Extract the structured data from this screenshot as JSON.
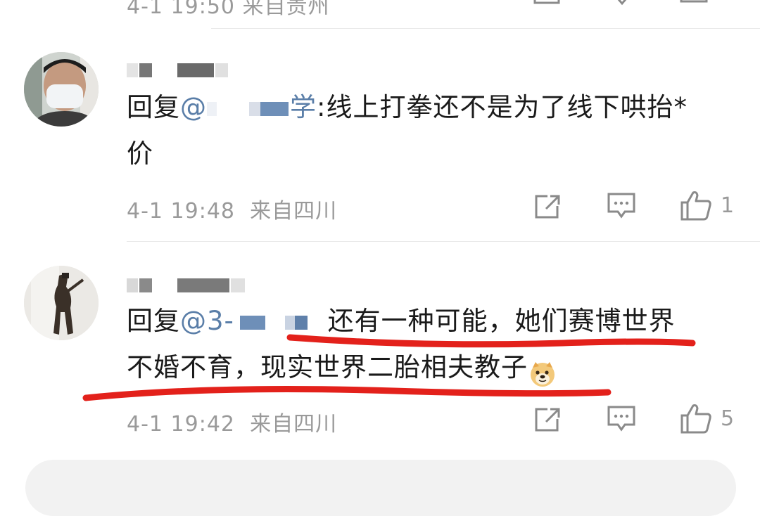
{
  "previous_comment": {
    "meta": "4-1 19:50 来自贵州"
  },
  "comments": [
    {
      "reply_prefix": "回复",
      "mention": "@",
      "mention_tail": "学",
      "text": ":线上打拳还不是为了线下哄抬*",
      "text_line2": "价",
      "time": "4-1 19:48",
      "location": "来自四川",
      "like_count": "1"
    },
    {
      "reply_prefix": "回复",
      "mention": "@3-",
      "text": "还有一种可能，她们赛博世界",
      "text_line2": "不婚不育，现实世界二胎相夫教子",
      "time": "4-1 19:42",
      "location": "来自四川",
      "like_count": "5"
    }
  ],
  "colors": {
    "mention": "#5a7ea8",
    "meta": "#9a9a9a",
    "highlight_underline": "#e3211b"
  },
  "icons": [
    "share-icon",
    "comment-icon",
    "like-icon",
    "doge-emoji"
  ]
}
